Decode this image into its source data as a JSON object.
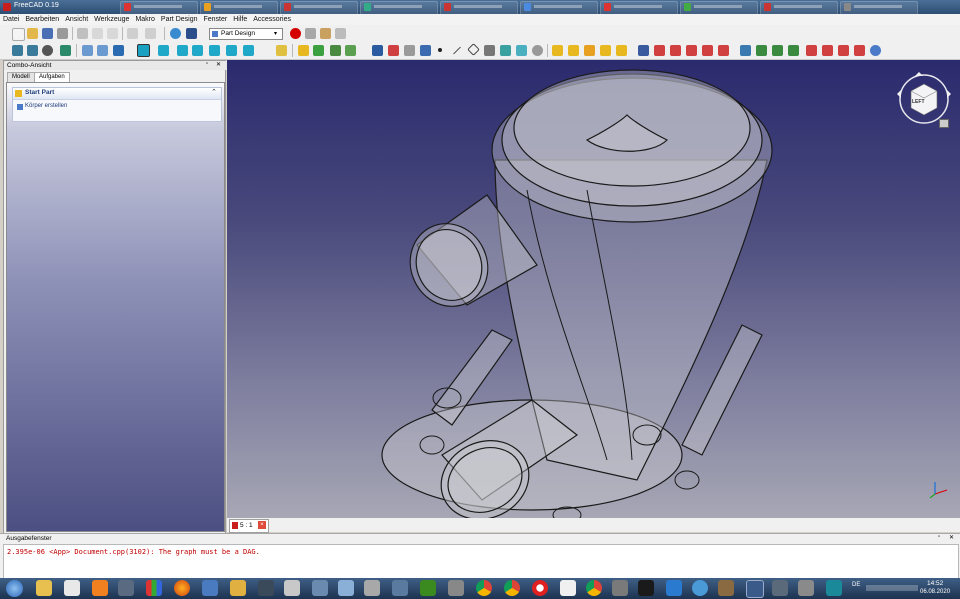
{
  "window": {
    "title": "FreeCAD 0.19"
  },
  "menu": [
    "Datei",
    "Bearbeiten",
    "Ansicht",
    "Werkzeuge",
    "Makro",
    "Part Design",
    "Fenster",
    "Hilfe",
    "Accessories"
  ],
  "toolbar": {
    "workbench": "Part Design"
  },
  "combo_view": {
    "title": "Combo-Ansicht",
    "tabs": [
      "Modell",
      "Aufgaben"
    ],
    "active_tab": "Aufgaben",
    "task_panel": {
      "title": "Start Part",
      "action": "Körper erstellen"
    }
  },
  "navigation_cube": {
    "face": "LEFT"
  },
  "document_tab": {
    "label": "5 : 1"
  },
  "output": {
    "title": "Ausgabefenster",
    "message": "2.395e-06 <App> Document.cpp(3102): The graph must be a DAG."
  },
  "taskbar": {
    "time": "14:52",
    "date": "06.08.2020",
    "lang": "DE"
  },
  "colors": {
    "title_bar": "#3a5d85",
    "viewport_top": "#2a2a6e",
    "viewport_bottom": "#a7a7b5",
    "record": "#d40000",
    "error_text": "#c00000"
  }
}
